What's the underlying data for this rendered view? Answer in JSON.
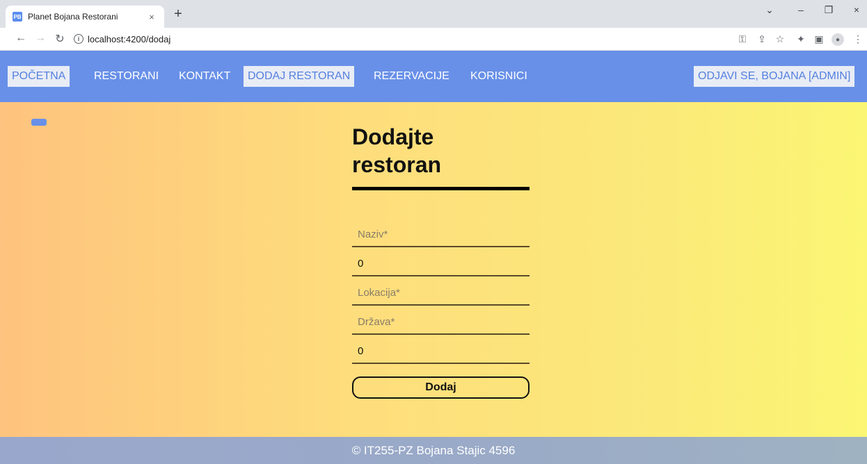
{
  "browser": {
    "tab_title": "Planet Bojana Restorani",
    "favicon_text": "PB",
    "tab_close": "×",
    "new_tab": "+",
    "url": "localhost:4200/dodaj",
    "window_controls": [
      "⌄",
      "–",
      "❐",
      "×"
    ]
  },
  "nav": {
    "items": [
      {
        "label": "POČETNA",
        "active": true
      },
      {
        "label": "RESTORANI",
        "active": false
      },
      {
        "label": "KONTAKT",
        "active": false
      },
      {
        "label": "DODAJ RESTORAN",
        "active": true
      },
      {
        "label": "REZERVACIJE",
        "active": false
      },
      {
        "label": "KORISNICI",
        "active": false
      }
    ],
    "logout": "ODJAVI SE, BOJANA [ADMIN]"
  },
  "form": {
    "heading_line1": "Dodajte",
    "heading_line2": "restoran",
    "fields": [
      {
        "placeholder": "Naziv*",
        "value": ""
      },
      {
        "placeholder": "",
        "value": "0"
      },
      {
        "placeholder": "Lokacija*",
        "value": ""
      },
      {
        "placeholder": "Država*",
        "value": ""
      },
      {
        "placeholder": "",
        "value": "0"
      }
    ],
    "submit_label": "Dodaj"
  },
  "footer": {
    "text": "© IT255-PZ Bojana Stajic 4596"
  },
  "colors": {
    "nav_bg": "#6890e8",
    "active_bg": "#e8ecf5"
  }
}
